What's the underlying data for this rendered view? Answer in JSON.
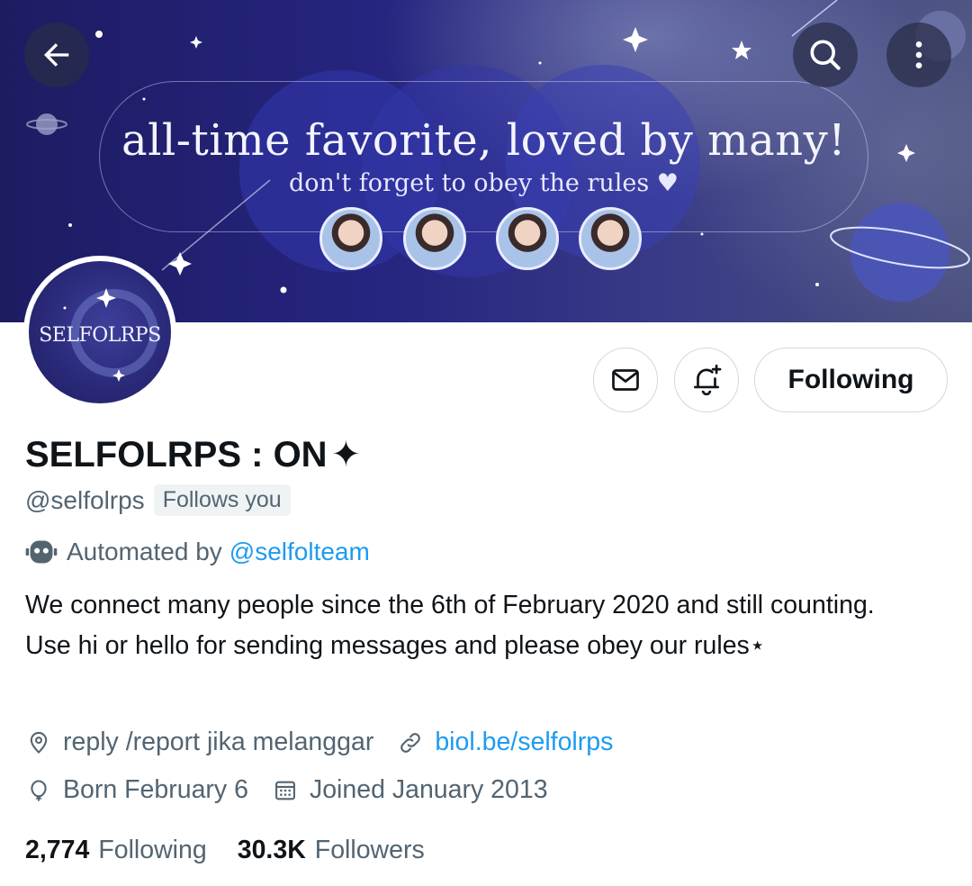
{
  "banner": {
    "title": "all-time favorite, loved by many!",
    "subtitle": "don't forget to obey the rules ♥"
  },
  "header_actions": {
    "back_icon": "arrow-left-icon",
    "search_icon": "search-icon",
    "more_icon": "more-vertical-icon"
  },
  "avatar": {
    "text": "SELFOLRPS"
  },
  "actions": {
    "message_icon": "envelope-icon",
    "notify_icon": "bell-plus-icon",
    "follow_label": "Following"
  },
  "profile": {
    "display_name": "SELFOLRPS : ON",
    "name_glyph": "✦",
    "handle": "@selfolrps",
    "follows_you": "Follows you",
    "automated_prefix": "Automated by",
    "automated_by": "@selfolteam",
    "bio_text": "We connect many people since the 6th of February 2020 and still counting. Use hi or hello for sending messages and please obey our rules⋆",
    "location": "reply /report jika melanggar",
    "website": "biol.be/selfolrps",
    "birthday": "Born February 6",
    "joined": "Joined January 2013"
  },
  "stats": {
    "following_count": "2,774",
    "following_label": "Following",
    "followers_count": "30.3K",
    "followers_label": "Followers"
  },
  "colors": {
    "accent": "#1d9bf0",
    "text_primary": "#0f1419",
    "text_secondary": "#536471",
    "border": "#cfd9de",
    "banner_dark": "#1d1c62"
  }
}
